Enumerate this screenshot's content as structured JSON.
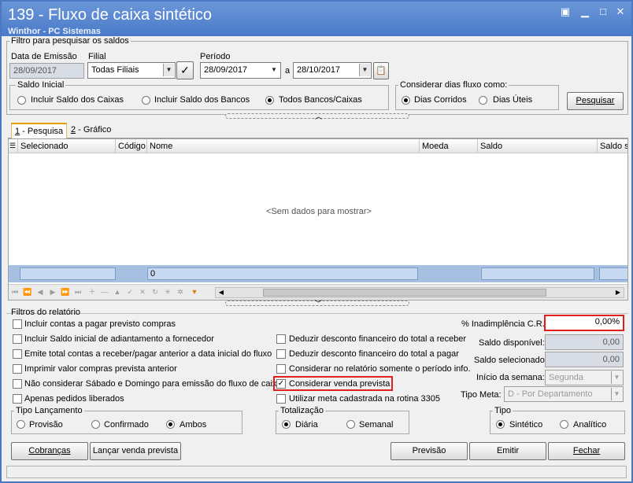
{
  "window": {
    "title": "139 - Fluxo de caixa sintético",
    "subtitle": "Winthor - PC Sistemas"
  },
  "filter": {
    "group_label": "Filtro para pesquisar os saldos",
    "emission_label": "Data de Emissão",
    "emission_value": "28/09/2017",
    "filial_label": "Filial",
    "filial_value": "Todas Filiais",
    "period_label": "Período",
    "period_from": "28/09/2017",
    "period_sep": "a",
    "period_to": "28/10/2017",
    "saldo_inicial": {
      "label": "Saldo Inicial",
      "options": [
        "Incluir Saldo dos Caixas",
        "Incluir Saldo dos Bancos",
        "Todos Bancos/Caixas"
      ],
      "selected": 2
    },
    "dias": {
      "label": "Considerar dias fluxo como:",
      "options": [
        "Dias Corridos",
        "Dias Úteis"
      ],
      "selected": 0
    },
    "search_button": "Pesquisar"
  },
  "tabs": [
    {
      "key": "1",
      "label": " - Pesquisa"
    },
    {
      "key": "2",
      "label": " - Gráfico"
    }
  ],
  "grid": {
    "columns": [
      "Selecionado",
      "Código",
      "Nome",
      "Moeda",
      "Saldo",
      "Saldo se"
    ],
    "empty_text": "<Sem dados para mostrar>",
    "footer_value": "0"
  },
  "report": {
    "group_label": "Filtros do relatório",
    "left_checks": [
      {
        "label": "Incluir contas a pagar previsto compras",
        "checked": false
      },
      {
        "label": "Incluir Saldo inicial de adiantamento a fornecedor",
        "checked": false
      },
      {
        "label": "Emite total contas a receber/pagar anterior a data inicial do fluxo",
        "checked": false
      },
      {
        "label": "Imprimir valor compras prevista anterior",
        "checked": false
      },
      {
        "label": "Não considerar Sábado e Domingo para emissão do fluxo de caixa",
        "checked": false
      },
      {
        "label": "Apenas pedidos liberados",
        "checked": false
      }
    ],
    "mid_checks": [
      {
        "label": "Deduzir desconto financeiro do total a receber",
        "checked": false
      },
      {
        "label": "Deduzir desconto financeiro do total a pagar",
        "checked": false
      },
      {
        "label": "Considerar no relatório somente o período info.",
        "checked": false
      },
      {
        "label": "Considerar venda prevista",
        "checked": true
      },
      {
        "label": "Utilizar meta cadastrada na rotina 3305",
        "checked": false
      }
    ],
    "inadimplencia_label": "% Inadimplência C.R.",
    "inadimplencia_value": "0,00%",
    "saldo_disp_label": "Saldo disponível:",
    "saldo_disp_value": "0,00",
    "saldo_sel_label": "Saldo selecionado:",
    "saldo_sel_value": "0,00",
    "inicio_semana_label": "Início da semana:",
    "inicio_semana_value": "Segunda",
    "tipo_meta_label": "Tipo Meta:",
    "tipo_meta_value": "D - Por Departamento",
    "tipo_lancamento": {
      "label": "Tipo Lançamento",
      "options": [
        "Provisão",
        "Confirmado",
        "Ambos"
      ],
      "selected": 2
    },
    "totalizacao": {
      "label": "Totalização",
      "options": [
        "Diária",
        "Semanal"
      ],
      "selected": 0
    },
    "tipo": {
      "label": "Tipo",
      "options": [
        "Sintético",
        "Analítico"
      ],
      "selected": 0
    }
  },
  "buttons": {
    "cobrancas": "Cobranças",
    "lancar": "Lançar venda prevista",
    "previsao": "Previsão",
    "emitir": "Emitir",
    "fechar": "Fechar"
  },
  "colors": {
    "title_bar": "#4a7bc9",
    "highlight": "#e02020"
  }
}
